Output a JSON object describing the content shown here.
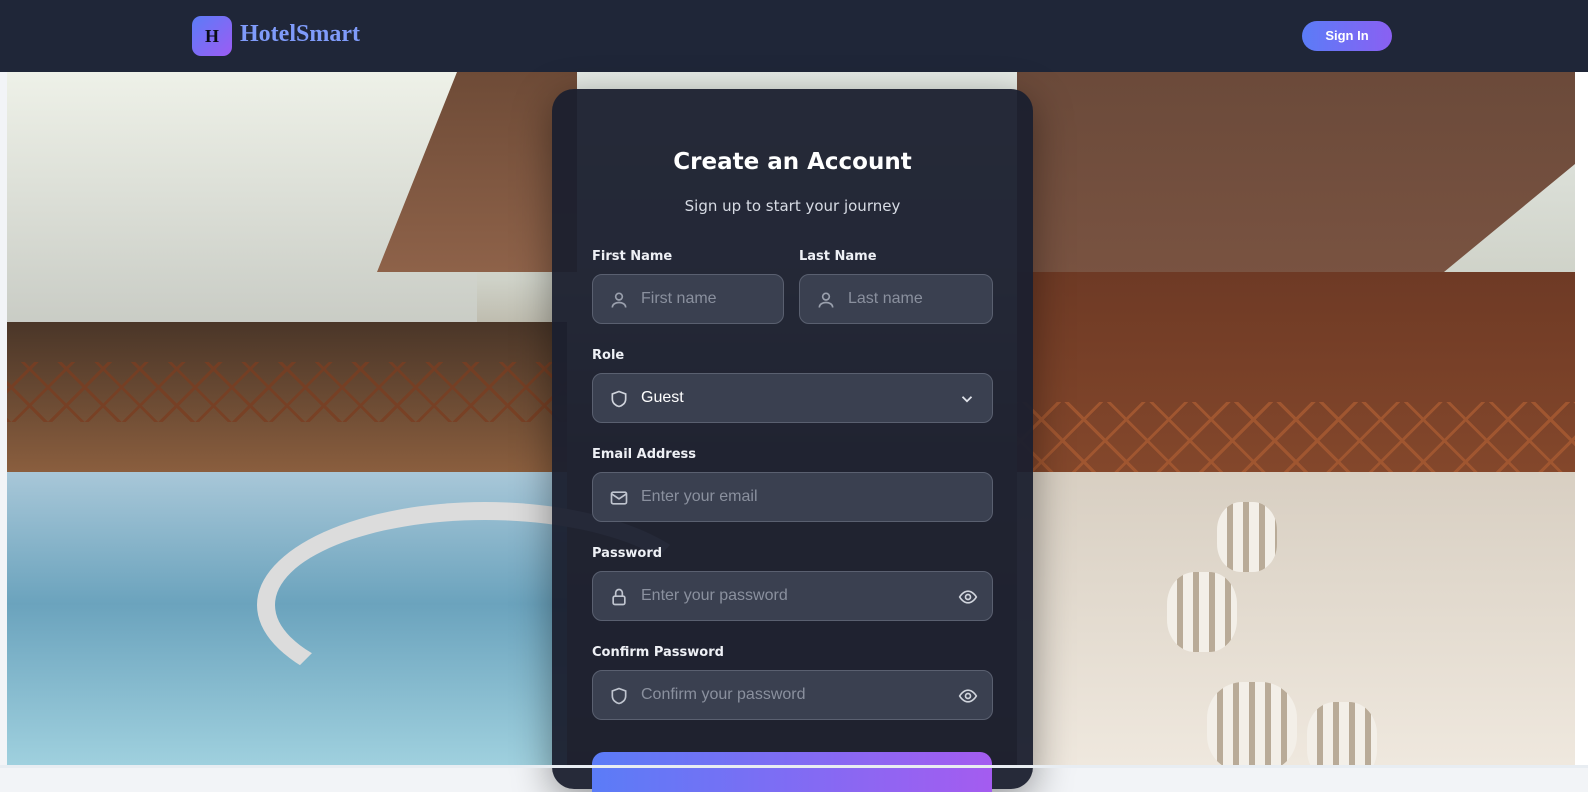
{
  "header": {
    "logo_letter": "H",
    "brand": "HotelSmart",
    "signin_label": "Sign In"
  },
  "form": {
    "title": "Create an Account",
    "subtitle": "Sign up to start your journey",
    "first_name": {
      "label": "First Name",
      "placeholder": "First name",
      "icon": "user-icon"
    },
    "last_name": {
      "label": "Last Name",
      "placeholder": "Last name",
      "icon": "user-icon"
    },
    "role": {
      "label": "Role",
      "value": "Guest",
      "icon": "shield-icon"
    },
    "email": {
      "label": "Email Address",
      "placeholder": "Enter your email",
      "icon": "mail-icon"
    },
    "password": {
      "label": "Password",
      "placeholder": "Enter your password",
      "icon": "lock-icon"
    },
    "confirm_password": {
      "label": "Confirm Password",
      "placeholder": "Confirm your password",
      "icon": "shield-icon"
    }
  },
  "colors": {
    "nav_bg": "#1f2638",
    "card_bg": "#1a1f2e",
    "accent_start": "#5b7cf7",
    "accent_end": "#a45cf0",
    "field_bg": "#3a4050"
  }
}
